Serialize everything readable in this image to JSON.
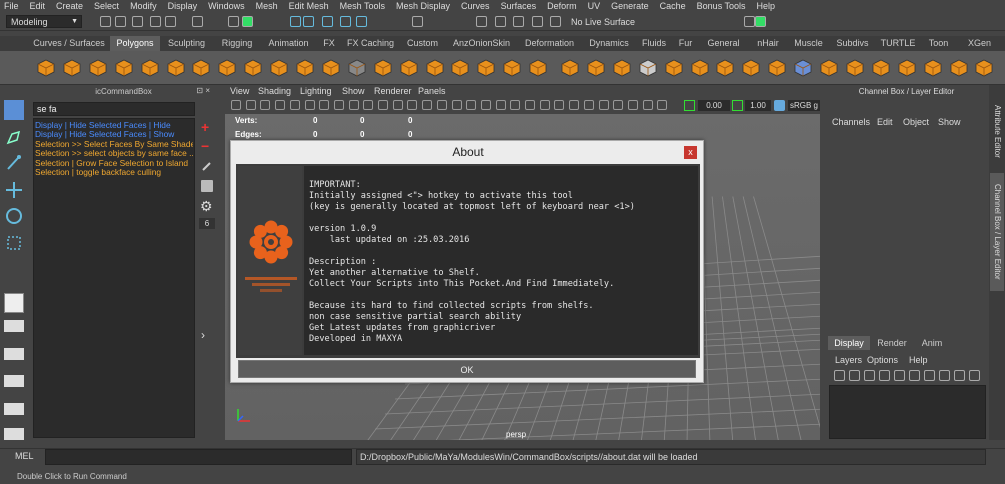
{
  "menubar": [
    "File",
    "Edit",
    "Create",
    "Select",
    "Modify",
    "Display",
    "Windows",
    "Mesh",
    "Edit Mesh",
    "Mesh Tools",
    "Mesh Display",
    "Curves",
    "Surfaces",
    "Deform",
    "UV",
    "Generate",
    "Cache",
    "Bonus Tools",
    "Help"
  ],
  "status": {
    "mode": "Modeling",
    "live_surface": "No Live Surface"
  },
  "shelf_tabs": [
    "Curves / Surfaces",
    "Polygons",
    "Sculpting",
    "Rigging",
    "Animation",
    "FX",
    "FX Caching",
    "Custom",
    "AnzOnionSkin",
    "Deformation",
    "Dynamics",
    "Fluids",
    "Fur",
    "General",
    "nHair",
    "Muscle",
    "Subdivs",
    "TURTLE",
    "Toon",
    "XGen"
  ],
  "shelf_active": "Polygons",
  "command_box": {
    "title": "icCommandBox",
    "search": "se fa",
    "results": [
      {
        "text": "Display | Hide Selected Faces | Hide",
        "color": "#4a8cff"
      },
      {
        "text": "Display | Hide Selected Faces | Show",
        "color": "#4a8cff"
      },
      {
        "text": "Selection >> Select Faces By Same Shader",
        "color": "#f0a830"
      },
      {
        "text": "Selection >> select objects by same face ...",
        "color": "#f0a830"
      },
      {
        "text": "Selection | Grow Face Selection to Island",
        "color": "#f0a830"
      },
      {
        "text": "Selection | toggle backface culling",
        "color": "#f0a830"
      }
    ],
    "count": "6"
  },
  "viewport": {
    "menu": [
      "View",
      "Shading",
      "Lighting",
      "Show",
      "Renderer",
      "Panels"
    ],
    "near": "0.00",
    "far": "1.00",
    "colorspace": "sRGB g",
    "hud": [
      {
        "label": "Verts:",
        "a": "0",
        "b": "0",
        "c": "0"
      },
      {
        "label": "Edges:",
        "a": "0",
        "b": "0",
        "c": "0"
      }
    ],
    "camera": "persp"
  },
  "channel_box": {
    "title": "Channel Box / Layer Editor",
    "menu": [
      "Channels",
      "Edit",
      "Object",
      "Show"
    ],
    "layer_tabs": [
      "Display",
      "Render",
      "Anim"
    ],
    "layer_menu": [
      "Layers",
      "Options",
      "Help"
    ]
  },
  "side_tabs": [
    "Attribute Editor",
    "Channel Box / Layer Editor"
  ],
  "dialog": {
    "title": "About",
    "close": "x",
    "ok": "OK",
    "lines": [
      "IMPORTANT:",
      "Initially assigned <\"> hotkey to activate this tool",
      "(key is generally located at topmost left of keyboard near <1>)",
      "",
      "version 1.0.9",
      "    last updated on :25.03.2016",
      "",
      "Description :",
      "Yet another alternative to Shelf.",
      "Collect Your Scripts into This Pocket.And Find Immediately.",
      "",
      "Because its hard to find collected scripts from shelfs.",
      "non case sensitive partial search ability",
      "Get Latest updates from graphicriver",
      "Developed in MAXYA"
    ]
  },
  "bottom": {
    "mel_label": "MEL",
    "mel_output": "D:/Dropbox/Public/MaYa/ModulesWin/CommandBox/scripts//about.dat will be loaded",
    "help": "Double Click to Run Command"
  },
  "colors": {
    "accent_orange": "#e8621c",
    "shelf_bg": "#5a5a5a",
    "active_tab": "#5d5d5d",
    "blue_result": "#4a8cff",
    "orange_result": "#f0a830"
  }
}
